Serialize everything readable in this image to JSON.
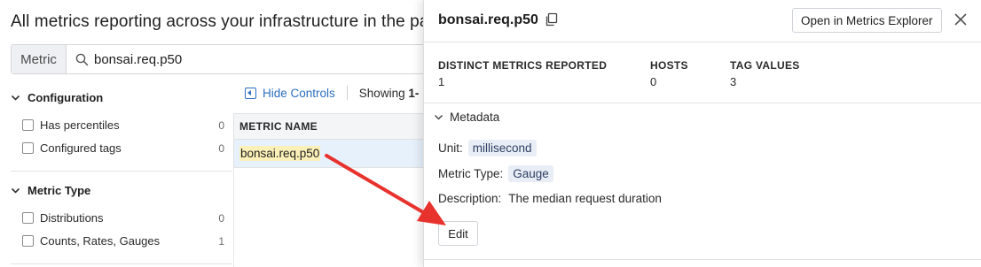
{
  "page": {
    "title": "All metrics reporting across your infrastructure in the past hour"
  },
  "search": {
    "prefix": "Metric",
    "value": "bonsai.req.p50",
    "icon": "search-icon"
  },
  "facets": {
    "groups": [
      {
        "title": "Configuration",
        "items": [
          {
            "label": "Has percentiles",
            "count": "0"
          },
          {
            "label": "Configured tags",
            "count": "0"
          }
        ]
      },
      {
        "title": "Metric Type",
        "items": [
          {
            "label": "Distributions",
            "count": "0"
          },
          {
            "label": "Counts, Rates, Gauges",
            "count": "1"
          }
        ]
      }
    ]
  },
  "controls": {
    "hide_label": "Hide Controls",
    "showing_prefix": "Showing",
    "showing_range": "1-"
  },
  "table": {
    "column_header": "METRIC NAME",
    "rows": [
      {
        "metric": "bonsai.req.p50"
      }
    ]
  },
  "side_panel": {
    "title": "bonsai.req.p50",
    "open_explorer_label": "Open in Metrics Explorer",
    "stats": [
      {
        "label": "DISTINCT METRICS REPORTED",
        "value": "1"
      },
      {
        "label": "HOSTS",
        "value": "0"
      },
      {
        "label": "TAG VALUES",
        "value": "3"
      }
    ],
    "metadata": {
      "section_label": "Metadata",
      "unit_label": "Unit:",
      "unit_value": "millisecond",
      "type_label": "Metric Type:",
      "type_value": "Gauge",
      "description_label": "Description:",
      "description_value": "The median request duration",
      "edit_label": "Edit"
    }
  },
  "colors": {
    "link_blue": "#2c6fbf",
    "highlight_yellow": "#fbf0b8",
    "row_selected": "#e7f1fb",
    "arrow_red": "#e8322d"
  }
}
